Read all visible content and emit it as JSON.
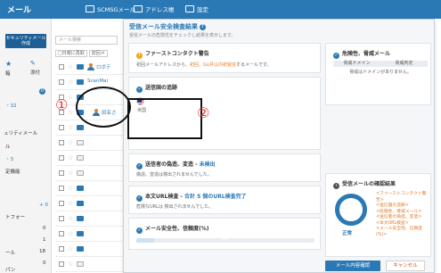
{
  "header": {
    "app_title": "メール",
    "nav": [
      {
        "label": "SCMSGメール",
        "icon": "mail-icon"
      },
      {
        "label": "アドレス帳",
        "icon": "address-book-icon"
      },
      {
        "label": "設定",
        "icon": "settings-icon"
      }
    ]
  },
  "sidebar": {
    "compose_label": "セキュリティメール作成",
    "attach_label": "添付",
    "items": [
      "箱",
      "・32",
      "ュリティメール",
      "ル",
      "・3",
      "定機能",
      "トフォー",
      "ール",
      "パン"
    ],
    "counts": [
      "0",
      "+ 0",
      "0",
      "1",
      "18",
      "0"
    ]
  },
  "list": {
    "search_placeholder": "メール検索",
    "filters": [
      "□日曜に再取",
      "前回メ"
    ],
    "rows": [
      {
        "sender": "ロボテ"
      },
      {
        "sender": "ScanMai"
      },
      {
        "sender": "田名さ"
      }
    ]
  },
  "dialog": {
    "title": "受信メール安全検査結果",
    "subtitle": "受信メールの危険性をチェックし結果を表示します。",
    "first_contact": {
      "heading": "ファーストコンタクト警告",
      "body_prefix": "初回メールアドレスから",
      "body_highlight": "初回、Go月以内初受信",
      "body_suffix": "するメールです。"
    },
    "origin_country": {
      "heading": "送信国の追跡",
      "country": "米国"
    },
    "danger_mail": {
      "heading": "危険性、脅威メール",
      "col1": "脅威ドメイン",
      "col2": "脅威判定",
      "empty": "脅威はドメインがありません。"
    },
    "sender_spoof": {
      "heading_prefix": "送信者の偽造、変造 - ",
      "heading_status": "未検出",
      "body": "偽造、変造は検出されませんでした。"
    },
    "url_check": {
      "heading_prefix": "本文URL検査 - ",
      "heading_status": "合計 5 個のURL検査完了",
      "body": "危険なURLは 検出されませんでした。"
    },
    "email_safety": {
      "heading": "メール安全性、信頼度(%)",
      "percent": "0%",
      "fill": 0.1
    },
    "summary": {
      "heading": "受信メールの確認結果",
      "status": "正常",
      "items": [
        "<ファーストコンタクト警告>",
        "<送信国の追跡>",
        "<危険性、脅威メール>",
        "<送信者の偽造、変造>",
        "<本文URL検査>",
        "<メール安全性、信頼度(%)>"
      ]
    },
    "confirm_button": "メール内容確認",
    "cancel_button": "キャンセル"
  },
  "annotations": [
    "①",
    "②"
  ],
  "colors": {
    "primary": "#2b79b4",
    "warning": "#f2a516",
    "orange": "#e07b2a",
    "danger": "#d84315",
    "annotation": "#e53935"
  }
}
